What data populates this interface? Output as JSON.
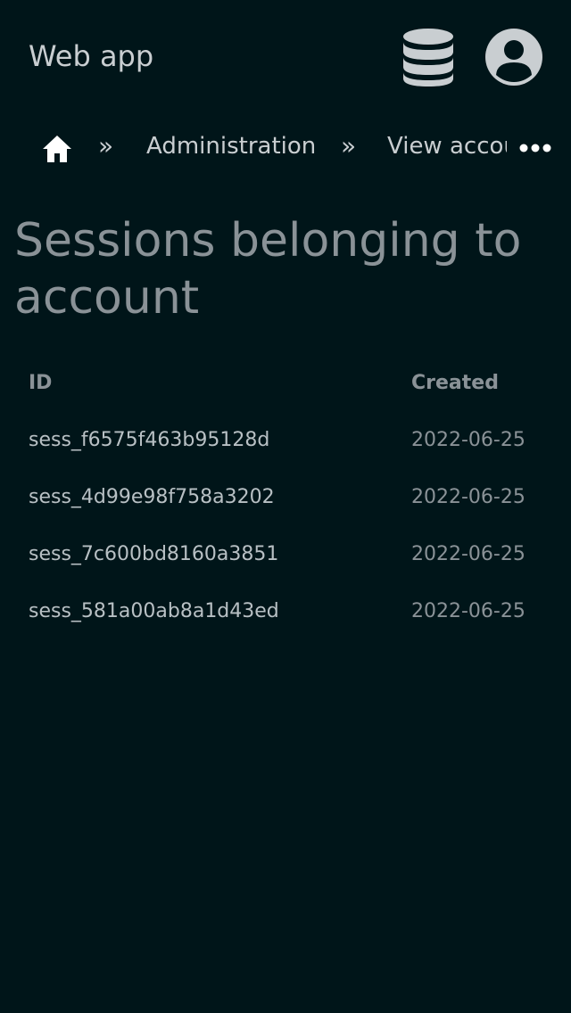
{
  "header": {
    "app_title": "Web app",
    "database_icon": "database-icon",
    "account_icon": "user-circle-icon"
  },
  "breadcrumb": {
    "home_icon": "home-icon",
    "separator": "»",
    "items": [
      {
        "label": "Administration"
      },
      {
        "label": "View account"
      }
    ],
    "more_icon": "more-horizontal-icon"
  },
  "page": {
    "title": "Sessions belonging to account"
  },
  "table": {
    "columns": [
      "ID",
      "Created"
    ],
    "rows": [
      {
        "id": "sess_f6575f463b95128d",
        "created": "2022-06-25"
      },
      {
        "id": "sess_4d99e98f758a3202",
        "created": "2022-06-25"
      },
      {
        "id": "sess_7c600bd8160a3851",
        "created": "2022-06-25"
      },
      {
        "id": "sess_581a00ab8a1d43ed",
        "created": "2022-06-25"
      }
    ]
  },
  "colors": {
    "background": "#001519",
    "text": "#c9ced1",
    "muted": "#8a9297"
  }
}
